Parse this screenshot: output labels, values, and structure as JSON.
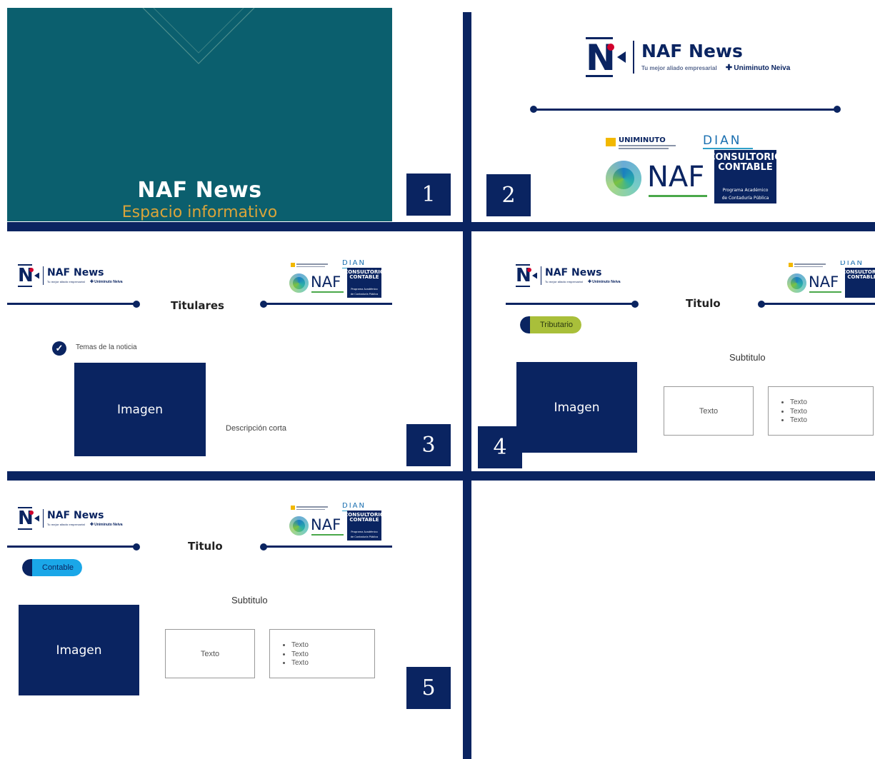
{
  "brand": {
    "name": "NAF News",
    "tagline": "Tu mejor aliado empresarial",
    "partner": "Uniminuto Neiva"
  },
  "partners": {
    "uniminuto": "UNIMINUTO",
    "dian": "DIAN",
    "naf": "NAF",
    "consultorio": "CONSULTORIO",
    "contable": "CONTABLE",
    "programa": "Programa Académico",
    "contaduria": "de Contaduría Pública"
  },
  "slide1": {
    "title": "NAF News",
    "subtitle": "Espacio informativo",
    "number": "1",
    "bg_color": "#0b5f6e",
    "accent": "#d9a43a"
  },
  "slide2": {
    "number": "2"
  },
  "slide3": {
    "number": "3",
    "heading": "Titulares",
    "topic": "Temas de la noticia",
    "image_label": "Imagen",
    "description": "Descripción corta"
  },
  "slide4": {
    "number": "4",
    "heading": "Titulo",
    "tag": "Tributario",
    "tag_color": "#a9bf3a",
    "subtitle": "Subtitulo",
    "image_label": "Imagen",
    "text_box": "Texto",
    "list": [
      "Texto",
      "Texto",
      "Texto"
    ]
  },
  "slide5": {
    "number": "5",
    "heading": "Titulo",
    "tag": "Contable",
    "tag_color": "#1aa7e8",
    "subtitle": "Subtitulo",
    "image_label": "Imagen",
    "text_box": "Texto",
    "list": [
      "Texto",
      "Texto",
      "Texto"
    ]
  },
  "colors": {
    "navy": "#0a2461",
    "naf_red": "#d1002c"
  }
}
